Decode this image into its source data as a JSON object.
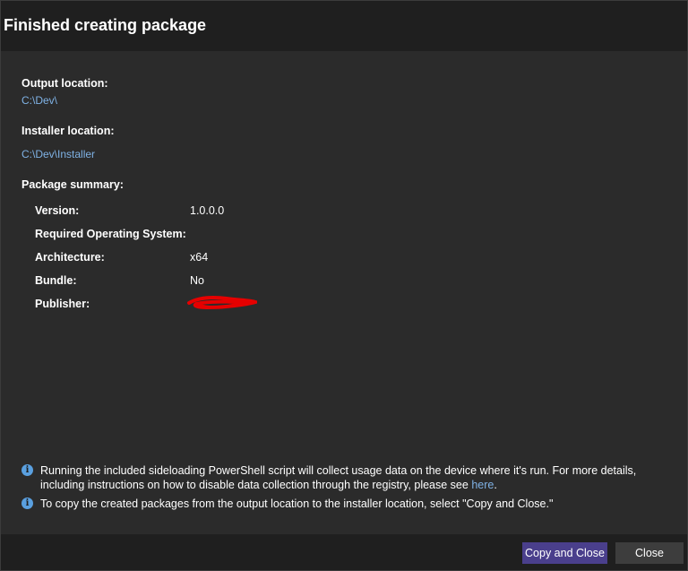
{
  "dialog": {
    "title": "Finished creating package"
  },
  "output": {
    "label": "Output location:",
    "path": "C:\\Dev\\"
  },
  "installer": {
    "label": "Installer location:",
    "path": "C:\\Dev\\Installer"
  },
  "summary": {
    "label": "Package summary:",
    "rows": [
      {
        "key": "Version:",
        "value": "1.0.0.0"
      },
      {
        "key": "Required Operating System:",
        "value": ""
      },
      {
        "key": "Architecture:",
        "value": "x64"
      },
      {
        "key": "Bundle:",
        "value": "No"
      },
      {
        "key": "Publisher:",
        "value": ""
      }
    ],
    "publisher_redaction_color": "#e60000"
  },
  "info": {
    "telemetry_text": "Running the included sideloading PowerShell script will collect usage data on the device where it's run.  For more details, including instructions on how to disable data collection through the registry, please see",
    "telemetry_link": "here",
    "telemetry_end": ".",
    "copy_text": "To copy the created packages from the output location to the installer location, select \"Copy and Close.\""
  },
  "buttons": {
    "copy_and_close": "Copy and Close",
    "close": "Close"
  },
  "colors": {
    "background": "#2b2b2b",
    "header": "#1f1f1f",
    "link": "#7fb2e5",
    "primary_button": "#4a3f8c",
    "secondary_button": "#3d3d3d",
    "info_icon": "#5aa0e0"
  },
  "icons": {
    "info": "info-circle-icon"
  }
}
